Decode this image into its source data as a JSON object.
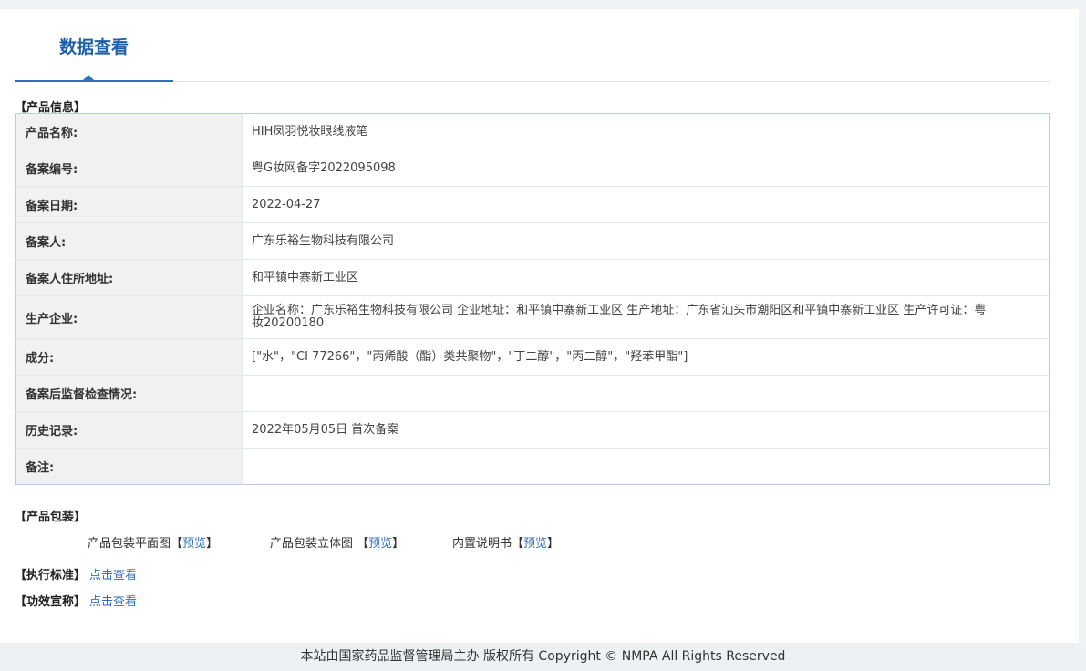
{
  "tab": {
    "label": "数据查看"
  },
  "product_info": {
    "title": "【产品信息】",
    "rows": [
      {
        "label": "产品名称:",
        "value": "HIH凤羽悦妆眼线液笔"
      },
      {
        "label": "备案编号:",
        "value": "粤G妆网备字2022095098"
      },
      {
        "label": "备案日期:",
        "value": "2022-04-27"
      },
      {
        "label": "备案人:",
        "value": "广东乐裕生物科技有限公司"
      },
      {
        "label": "备案人住所地址:",
        "value": "和平镇中寨新工业区"
      },
      {
        "label": "生产企业:",
        "value": "企业名称：广东乐裕生物科技有限公司 企业地址：和平镇中寨新工业区 生产地址：广东省汕头市潮阳区和平镇中寨新工业区 生产许可证：粤妆20200180"
      },
      {
        "label": "成分:",
        "value": "[\"水\"，\"CI 77266\"，\"丙烯酸（酯）类共聚物\"，\"丁二醇\"，\"丙二醇\"，\"羟苯甲酯\"]"
      },
      {
        "label": "备案后监督检查情况:",
        "value": ""
      },
      {
        "label": "历史记录:",
        "value": "2022年05月05日 首次备案"
      },
      {
        "label": "备注:",
        "value": ""
      }
    ]
  },
  "packaging": {
    "title": "【产品包装】",
    "items": [
      {
        "name": "产品包装平面图",
        "open": "【",
        "link": "预览",
        "close": "】"
      },
      {
        "name": "产品包装立体图 ",
        "open": "【",
        "link": "预览",
        "close": "】"
      },
      {
        "name": "内置说明书",
        "open": "【",
        "link": "预览",
        "close": "】"
      }
    ]
  },
  "standard": {
    "title": "【执行标准】",
    "link": "点击查看"
  },
  "efficacy": {
    "title": "【功效宣称】",
    "link": "点击查看"
  },
  "footer": {
    "text": "本站由国家药品监督管理局主办 版权所有 Copyright © NMPA All Rights Reserved"
  },
  "colors": {
    "accent": "#2b73c0",
    "link": "#2f6fb5",
    "label_bg": "#f1f1f1",
    "table_border": "#b7cbe6"
  }
}
